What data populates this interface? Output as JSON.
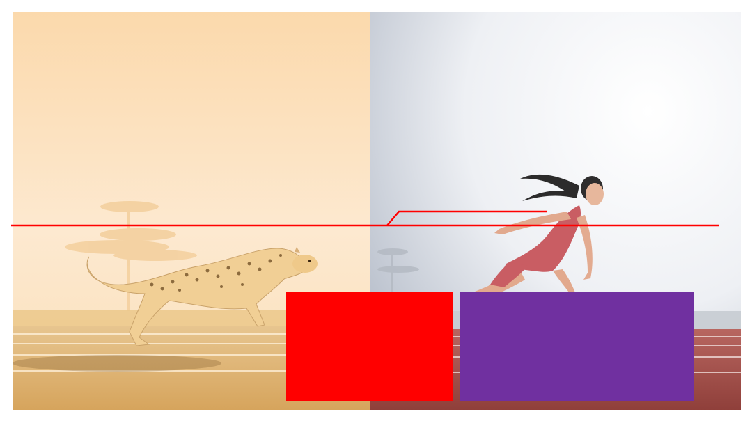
{
  "scene": {
    "left_panel": {
      "subject": "cheetah-icon",
      "tint": "#fde3bf"
    },
    "right_panel": {
      "subject": "sprinter-icon",
      "tint": "#e9ecf1",
      "track_color": "#a5514c"
    }
  },
  "annotations": {
    "line_color": "#ff0000",
    "red_block_color": "#ff0000",
    "purple_block_color": "#7030a0"
  }
}
